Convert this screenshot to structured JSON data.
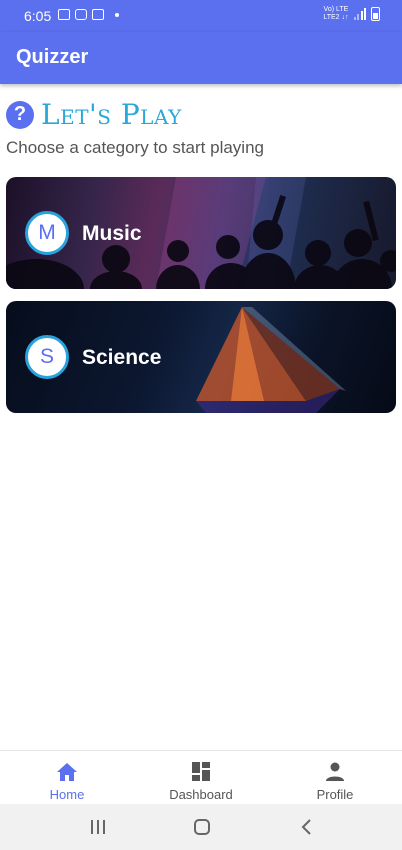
{
  "status_bar": {
    "time": "6:05",
    "network_top": "Vo) LTE",
    "network_bottom": "LTE2 ↓↑",
    "icons": [
      "gallery-icon",
      "youtube-icon",
      "app-icon",
      "dot-icon",
      "signal-icon",
      "battery-icon"
    ]
  },
  "app_bar": {
    "title": "Quizzer"
  },
  "heading": {
    "icon": "question-mark-icon",
    "text": "Let's Play"
  },
  "subtitle": "Choose a category to start playing",
  "categories": [
    {
      "letter": "M",
      "name": "Music"
    },
    {
      "letter": "S",
      "name": "Science"
    }
  ],
  "bottom_nav": [
    {
      "label": "Home",
      "icon": "home-icon",
      "active": true
    },
    {
      "label": "Dashboard",
      "icon": "dashboard-icon",
      "active": false
    },
    {
      "label": "Profile",
      "icon": "person-icon",
      "active": false
    }
  ],
  "system_nav": [
    "recents-icon",
    "home-circle-icon",
    "back-icon"
  ],
  "colors": {
    "primary": "#5b70ef",
    "heading": "#29a8d9",
    "avatar_border": "#2aa2dd",
    "nav_inactive": "#555555",
    "system_nav_bg": "#f1f1f1"
  }
}
